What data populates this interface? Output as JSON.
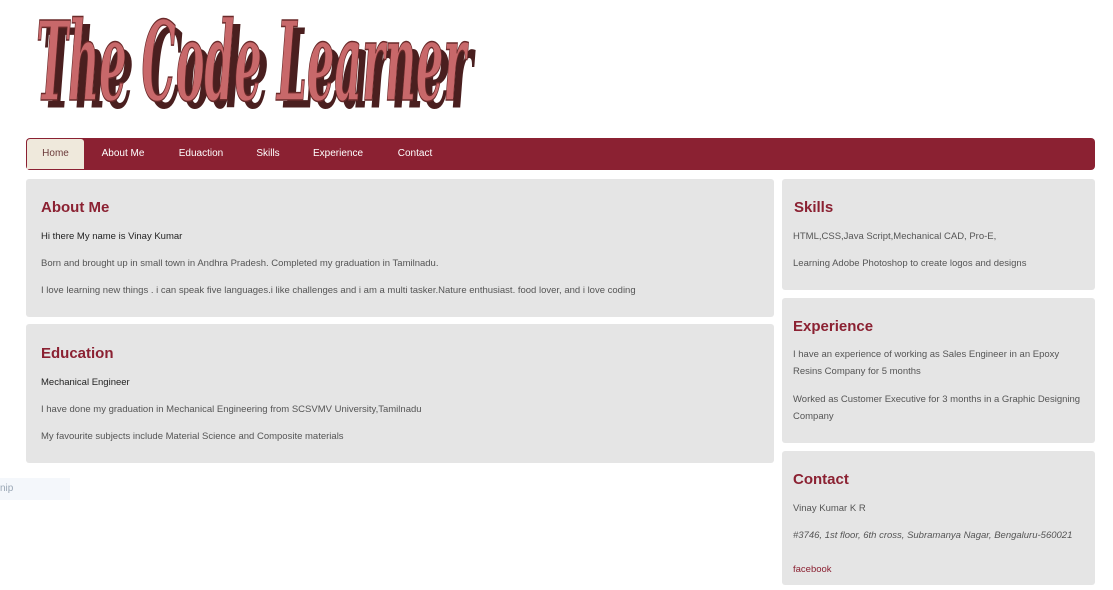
{
  "logo": {
    "text": "The Code Learner"
  },
  "nav": {
    "items": [
      {
        "label": "Home"
      },
      {
        "label": "About Me"
      },
      {
        "label": "Eduaction"
      },
      {
        "label": "Skills"
      },
      {
        "label": "Experience"
      },
      {
        "label": "Contact"
      }
    ]
  },
  "about": {
    "title": "About Me",
    "intro": "Hi there My name is Vinay Kumar",
    "p1": "Born and brought up in small town in Andhra Pradesh. Completed my graduation in Tamilnadu.",
    "p2": "I love learning new things . i can speak five languages.i like challenges and i am a multi tasker.Nature enthusiast. food lover, and i love coding"
  },
  "education": {
    "title": "Education",
    "degree": "Mechanical Engineer",
    "p1": "I have done my graduation in Mechanical Engineering from SCSVMV University,Tamilnadu",
    "p2": "My favourite subjects include Material Science and Composite materials"
  },
  "skills": {
    "title": "Skills",
    "p1": "HTML,CSS,Java Script,Mechanical CAD, Pro-E,",
    "p2": "Learning Adobe Photoshop to create logos and designs"
  },
  "experience": {
    "title": "Experience",
    "p1": "I have an experience of working as Sales Engineer in an Epoxy Resins Company for 5 months",
    "p2": "Worked as Customer Executive for 3 months in a Graphic Designing Company"
  },
  "contact": {
    "title": "Contact",
    "name": "Vinay Kumar K R",
    "address": "#3746, 1st floor, 6th cross, Subramanya Nagar, Bengaluru-560021",
    "link": "facebook"
  },
  "snip": {
    "text": "nip"
  },
  "colors": {
    "accent": "#8b2132",
    "panel": "#e5e5e5",
    "logo": "#c8686a",
    "logo_shadow": "#4a1f1f"
  }
}
